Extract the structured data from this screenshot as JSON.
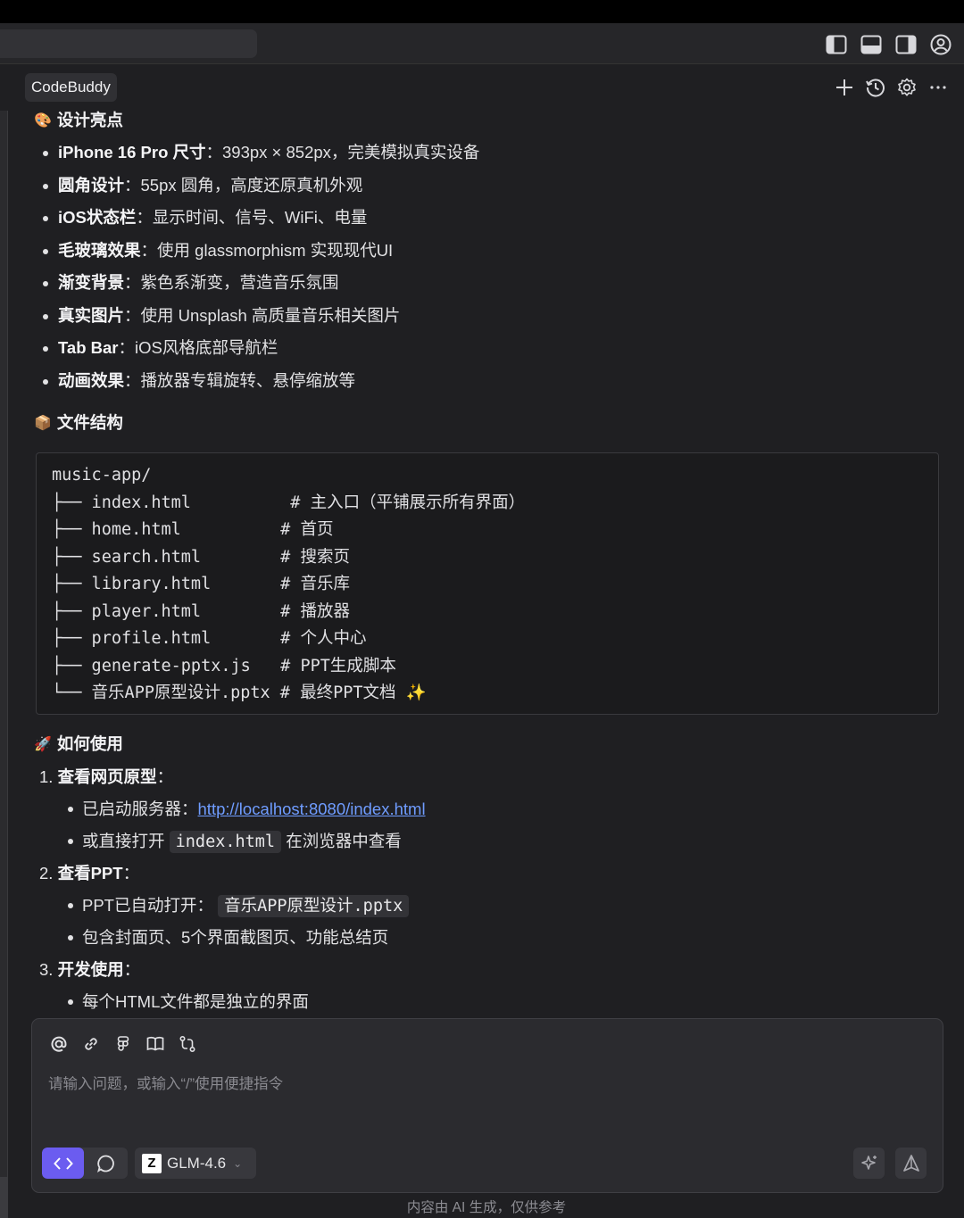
{
  "panel": {
    "tab_label": "CodeBuddy"
  },
  "sections": {
    "design": {
      "emoji": "🎨",
      "title": "设计亮点",
      "items": [
        {
          "label": "iPhone 16 Pro 尺寸",
          "text": "：393px × 852px，完美模拟真实设备"
        },
        {
          "label": "圆角设计",
          "text": "：55px 圆角，高度还原真机外观"
        },
        {
          "label": "iOS状态栏",
          "text": "：显示时间、信号、WiFi、电量"
        },
        {
          "label": "毛玻璃效果",
          "text": "：使用 glassmorphism 实现现代UI"
        },
        {
          "label": "渐变背景",
          "text": "：紫色系渐变，营造音乐氛围"
        },
        {
          "label": "真实图片",
          "text": "：使用 Unsplash 高质量音乐相关图片"
        },
        {
          "label": "Tab Bar",
          "text": "：iOS风格底部导航栏"
        },
        {
          "label": "动画效果",
          "text": "：播放器专辑旋转、悬停缩放等"
        }
      ]
    },
    "files": {
      "emoji": "📦",
      "title": "文件结构",
      "code_lines": [
        "music-app/",
        "├── index.html          # 主入口（平铺展示所有界面）",
        "├── home.html          # 首页",
        "├── search.html        # 搜索页",
        "├── library.html       # 音乐库",
        "├── player.html        # 播放器",
        "├── profile.html       # 个人中心",
        "├── generate-pptx.js   # PPT生成脚本",
        "└── 音乐APP原型设计.pptx # 最终PPT文档 ✨"
      ]
    },
    "usage": {
      "emoji": "🚀",
      "title": "如何使用",
      "step1": {
        "num": "1.",
        "title": "查看网页原型",
        "colon": "：",
        "a_prefix": "已启动服务器：",
        "a_link": "http://localhost:8080/index.html",
        "b_prefix": "或直接打开",
        "b_code": "index.html",
        "b_suffix": "在浏览器中查看"
      },
      "step2": {
        "num": "2.",
        "title": "查看PPT",
        "colon": "：",
        "a_prefix": "PPT已自动打开：",
        "a_code": "音乐APP原型设计.pptx",
        "b_text": "包含封面页、5个界面截图页、功能总结页"
      },
      "step3": {
        "num": "3.",
        "title": "开发使用",
        "colon": "：",
        "a_text": "每个HTML文件都是独立的界面"
      }
    }
  },
  "input": {
    "placeholder": "请输入问题，或输入“/”使用便捷指令",
    "model": "GLM-4.6",
    "accent": "#6b5cf0"
  },
  "footer": {
    "note": "内容由 AI 生成，仅供参考"
  }
}
